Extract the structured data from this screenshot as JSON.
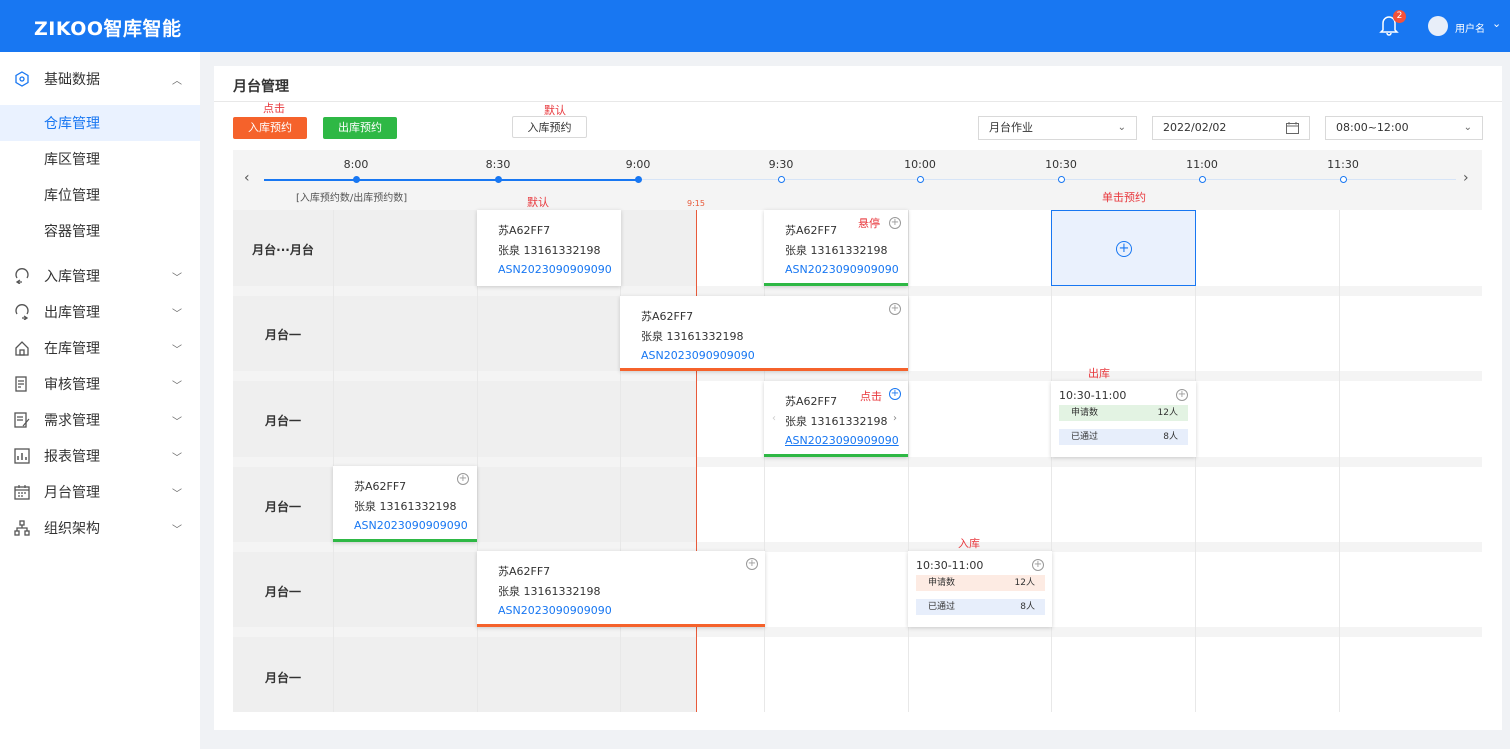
{
  "app": {
    "brand": "ZIKOO智库智能",
    "username": "用户名",
    "notif_count": "2"
  },
  "sidebar": {
    "group_open": "基础数据",
    "sub_items": [
      "仓库管理",
      "库区管理",
      "库位管理",
      "容器管理"
    ],
    "groups": [
      "入库管理",
      "出库管理",
      "在库管理",
      "审核管理",
      "需求管理",
      "报表管理",
      "月台管理",
      "组织架构"
    ]
  },
  "page": {
    "title": "月台管理"
  },
  "notes": {
    "click": "点击",
    "default": "默认",
    "default2": "默认",
    "hover": "悬停",
    "click2": "点击",
    "single_click": "单击预约",
    "outbound": "出库",
    "inbound": "入库"
  },
  "toolbar": {
    "inbound_btn": "入库预约",
    "outbound_btn": "出库预约",
    "default_btn": "入库预约",
    "task_select": "月台作业",
    "date": "2022/02/02",
    "time_range": "08:00~12:00"
  },
  "timeline": {
    "ticks": [
      "8:00",
      "8:30",
      "9:00",
      "9:30",
      "10:00",
      "10:30",
      "11:00",
      "11:30"
    ],
    "legend": "[入库预约数/出库预约数]",
    "now": "9:15"
  },
  "rows": [
    "月台···月台",
    "月台一",
    "月台一",
    "月台一",
    "月台一",
    "月台一"
  ],
  "card": {
    "plate": "苏A62FF7",
    "person": "张泉 13161332198",
    "asn": "ASN2023090909090"
  },
  "summary_out": {
    "time": "10:30-11:00",
    "applied_label": "申请数",
    "applied": "12人",
    "passed_label": "已通过",
    "passed": "8人"
  },
  "summary_in": {
    "time": "10:30-11:00",
    "applied_label": "申请数",
    "applied": "12人",
    "passed_label": "已通过",
    "passed": "8人"
  },
  "colors": {
    "brand": "#1877f2",
    "orange": "#f5622b",
    "green": "#2eb845",
    "now_line": "#e85a3a"
  }
}
